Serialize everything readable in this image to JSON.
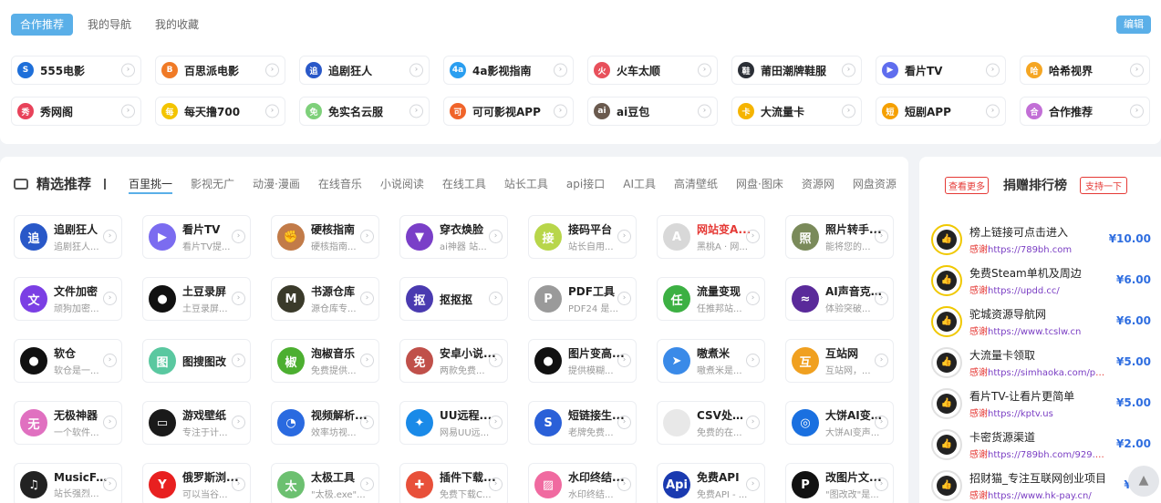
{
  "top": {
    "tabs": [
      "合作推荐",
      "我的导航",
      "我的收藏"
    ],
    "edit_label": "编辑",
    "sites": [
      {
        "name": "555电影",
        "color": "#1e6fd9",
        "icon": "S"
      },
      {
        "name": "百思派电影",
        "color": "#f07a26",
        "icon": "B"
      },
      {
        "name": "追剧狂人",
        "color": "#2958c8",
        "icon": "追"
      },
      {
        "name": "4a影视指南",
        "color": "#2a9ef0",
        "icon": "4a"
      },
      {
        "name": "火车太顺",
        "color": "#e8505b",
        "icon": "火"
      },
      {
        "name": "莆田潮牌鞋服",
        "color": "#2b2f36",
        "icon": "鞋"
      },
      {
        "name": "看片TV",
        "color": "#5f6dee",
        "icon": "▶"
      },
      {
        "name": "哈希视界",
        "color": "#f5a623",
        "icon": "哈"
      },
      {
        "name": "秀网阁",
        "color": "#e8425a",
        "icon": "秀"
      },
      {
        "name": "每天撸700",
        "color": "#f3c400",
        "icon": "每"
      },
      {
        "name": "免实名云服",
        "color": "#7ed07a",
        "icon": "免"
      },
      {
        "name": "可可影视APP",
        "color": "#f0642a",
        "icon": "可"
      },
      {
        "name": "ai豆包",
        "color": "#6a5a4e",
        "icon": "ai"
      },
      {
        "name": "大流量卡",
        "color": "#f5b400",
        "icon": "卡"
      },
      {
        "name": "短剧APP",
        "color": "#f5a000",
        "icon": "短"
      },
      {
        "name": "合作推荐",
        "color": "#c26fd6",
        "icon": "合"
      }
    ]
  },
  "main": {
    "section_title": "精选推荐",
    "categories": [
      "百里挑一",
      "影视无广",
      "动漫·漫画",
      "在线音乐",
      "小说阅读",
      "在线工具",
      "站长工具",
      "api接口",
      "AI工具",
      "高清壁纸",
      "网盘·图床",
      "资源网",
      "网盘资源"
    ],
    "apps": [
      {
        "name": "追剧狂人",
        "desc": "追剧狂人...",
        "color": "#2958c8",
        "icon": "追",
        "red": false
      },
      {
        "name": "看片TV",
        "desc": "看片TV提...",
        "color": "#7b6cf0",
        "icon": "▶",
        "red": false
      },
      {
        "name": "硬核指南",
        "desc": "硬核指南...",
        "color": "#c27b48",
        "icon": "✊",
        "red": false
      },
      {
        "name": "穿衣焕脸",
        "desc": "ai神器 站...",
        "color": "#7a3fc8",
        "icon": "▼",
        "red": false
      },
      {
        "name": "接码平台",
        "desc": "站长自用...",
        "color": "#b8d64a",
        "icon": "接",
        "red": false
      },
      {
        "name": "网站变A...",
        "desc": "黑桃A · 网...",
        "color": "#d8d8d8",
        "icon": "A",
        "red": true
      },
      {
        "name": "照片转手...",
        "desc": "能将您的...",
        "color": "#7a8a5a",
        "icon": "照",
        "red": false
      },
      {
        "name": "文件加密",
        "desc": "顽狗加密...",
        "color": "#7b3fe4",
        "icon": "文",
        "red": false
      },
      {
        "name": "土豆录屏",
        "desc": "土豆录屏...",
        "color": "#111111",
        "icon": "●",
        "red": false
      },
      {
        "name": "书源仓库",
        "desc": "源仓库专...",
        "color": "#3a3a2a",
        "icon": "M",
        "red": false
      },
      {
        "name": "抠抠抠",
        "desc": "",
        "color": "#4a3ab0",
        "icon": "抠",
        "red": false
      },
      {
        "name": "PDF工具",
        "desc": "PDF24 是...",
        "color": "#9a9a9a",
        "icon": "P",
        "red": false
      },
      {
        "name": "流量变现",
        "desc": "任推邦站...",
        "color": "#3cb043",
        "icon": "任",
        "red": false
      },
      {
        "name": "AI声音克...",
        "desc": "体验突破...",
        "color": "#5a2a9a",
        "icon": "≈",
        "red": false
      },
      {
        "name": "软仓",
        "desc": "软仓是一...",
        "color": "#111111",
        "icon": "●",
        "red": false
      },
      {
        "name": "图搜图改",
        "desc": "",
        "color": "#5ac8a0",
        "icon": "图",
        "red": false
      },
      {
        "name": "泡椒音乐",
        "desc": "免费提供...",
        "color": "#4caf30",
        "icon": "椒",
        "red": false
      },
      {
        "name": "安卓小说...",
        "desc": "两款免费...",
        "color": "#c0504a",
        "icon": "免",
        "red": false
      },
      {
        "name": "图片变高...",
        "desc": "提供模糊...",
        "color": "#111111",
        "icon": "●",
        "red": false
      },
      {
        "name": "嗷煮米",
        "desc": "嗷煮米是...",
        "color": "#3a8ae8",
        "icon": "➤",
        "red": false
      },
      {
        "name": "互站网",
        "desc": "互站网，...",
        "color": "#f0a020",
        "icon": "互",
        "red": false
      },
      {
        "name": "无极神器",
        "desc": "一个软件...",
        "color": "#e070c0",
        "icon": "无",
        "red": false
      },
      {
        "name": "游戏壁纸",
        "desc": "专注于计...",
        "color": "#1a1a1a",
        "icon": "▭",
        "red": false
      },
      {
        "name": "视频解析...",
        "desc": "效率坊视...",
        "color": "#2a6ae0",
        "icon": "◔",
        "red": false
      },
      {
        "name": "UU远程...",
        "desc": "网易UU远...",
        "color": "#1a8ae8",
        "icon": "✦",
        "red": false
      },
      {
        "name": "短链接生...",
        "desc": "老牌免费...",
        "color": "#2a60d8",
        "icon": "S",
        "red": false
      },
      {
        "name": "CSV处理...",
        "desc": "免费的在...",
        "color": "#e8e8e8",
        "icon": "",
        "red": false
      },
      {
        "name": "大饼AI变...",
        "desc": "大饼AI变声...",
        "color": "#1a70e0",
        "icon": "◎",
        "red": false
      },
      {
        "name": "MusicFree",
        "desc": "站长强烈...",
        "color": "#222222",
        "icon": "♫",
        "red": false
      },
      {
        "name": "俄罗斯浏...",
        "desc": "可以当谷...",
        "color": "#e82020",
        "icon": "Y",
        "red": false
      },
      {
        "name": "太极工具",
        "desc": "\"太极.exe\"...",
        "color": "#6cc070",
        "icon": "太",
        "red": false
      },
      {
        "name": "插件下载...",
        "desc": "免费下载C...",
        "color": "#e8503a",
        "icon": "✚",
        "red": false
      },
      {
        "name": "水印终结...",
        "desc": "水印终结...",
        "color": "#f06aa0",
        "icon": "▨",
        "red": false
      },
      {
        "name": "免费API",
        "desc": "免费API - ...",
        "color": "#1a3ab0",
        "icon": "Api",
        "red": false
      },
      {
        "name": "改图片文...",
        "desc": "\"图改改\"是...",
        "color": "#111111",
        "icon": "P",
        "red": false
      }
    ]
  },
  "rank": {
    "more_label": "查看更多",
    "title": "捐赠排行榜",
    "support_label": "支持一下",
    "url_prefix": "感谢",
    "items": [
      {
        "name": "榜上链接可点击进入",
        "url": "https://789bh.com",
        "amount": "¥10.00",
        "gold": true
      },
      {
        "name": "免费Steam单机及周边",
        "url": "https://updd.cc/",
        "amount": "¥6.00",
        "gold": true
      },
      {
        "name": "驼城资源导航网",
        "url": "https://www.tcslw.cn",
        "amount": "¥6.00",
        "gold": true
      },
      {
        "name": "大流量卡领取",
        "url": "https://simhaoka.com/pho...",
        "amount": "¥5.00",
        "gold": false
      },
      {
        "name": "看片TV-让看片更简单",
        "url": "https://kptv.us",
        "amount": "¥5.00",
        "gold": false
      },
      {
        "name": "卡密货源渠道",
        "url": "https://789bh.com/929.html",
        "amount": "¥2.00",
        "gold": false
      },
      {
        "name": "招财猫_专注互联网创业项目",
        "url": "https://www.hk-pay.cn/",
        "amount": "¥2.0",
        "gold": false
      }
    ]
  },
  "back_top_icon": "▲"
}
